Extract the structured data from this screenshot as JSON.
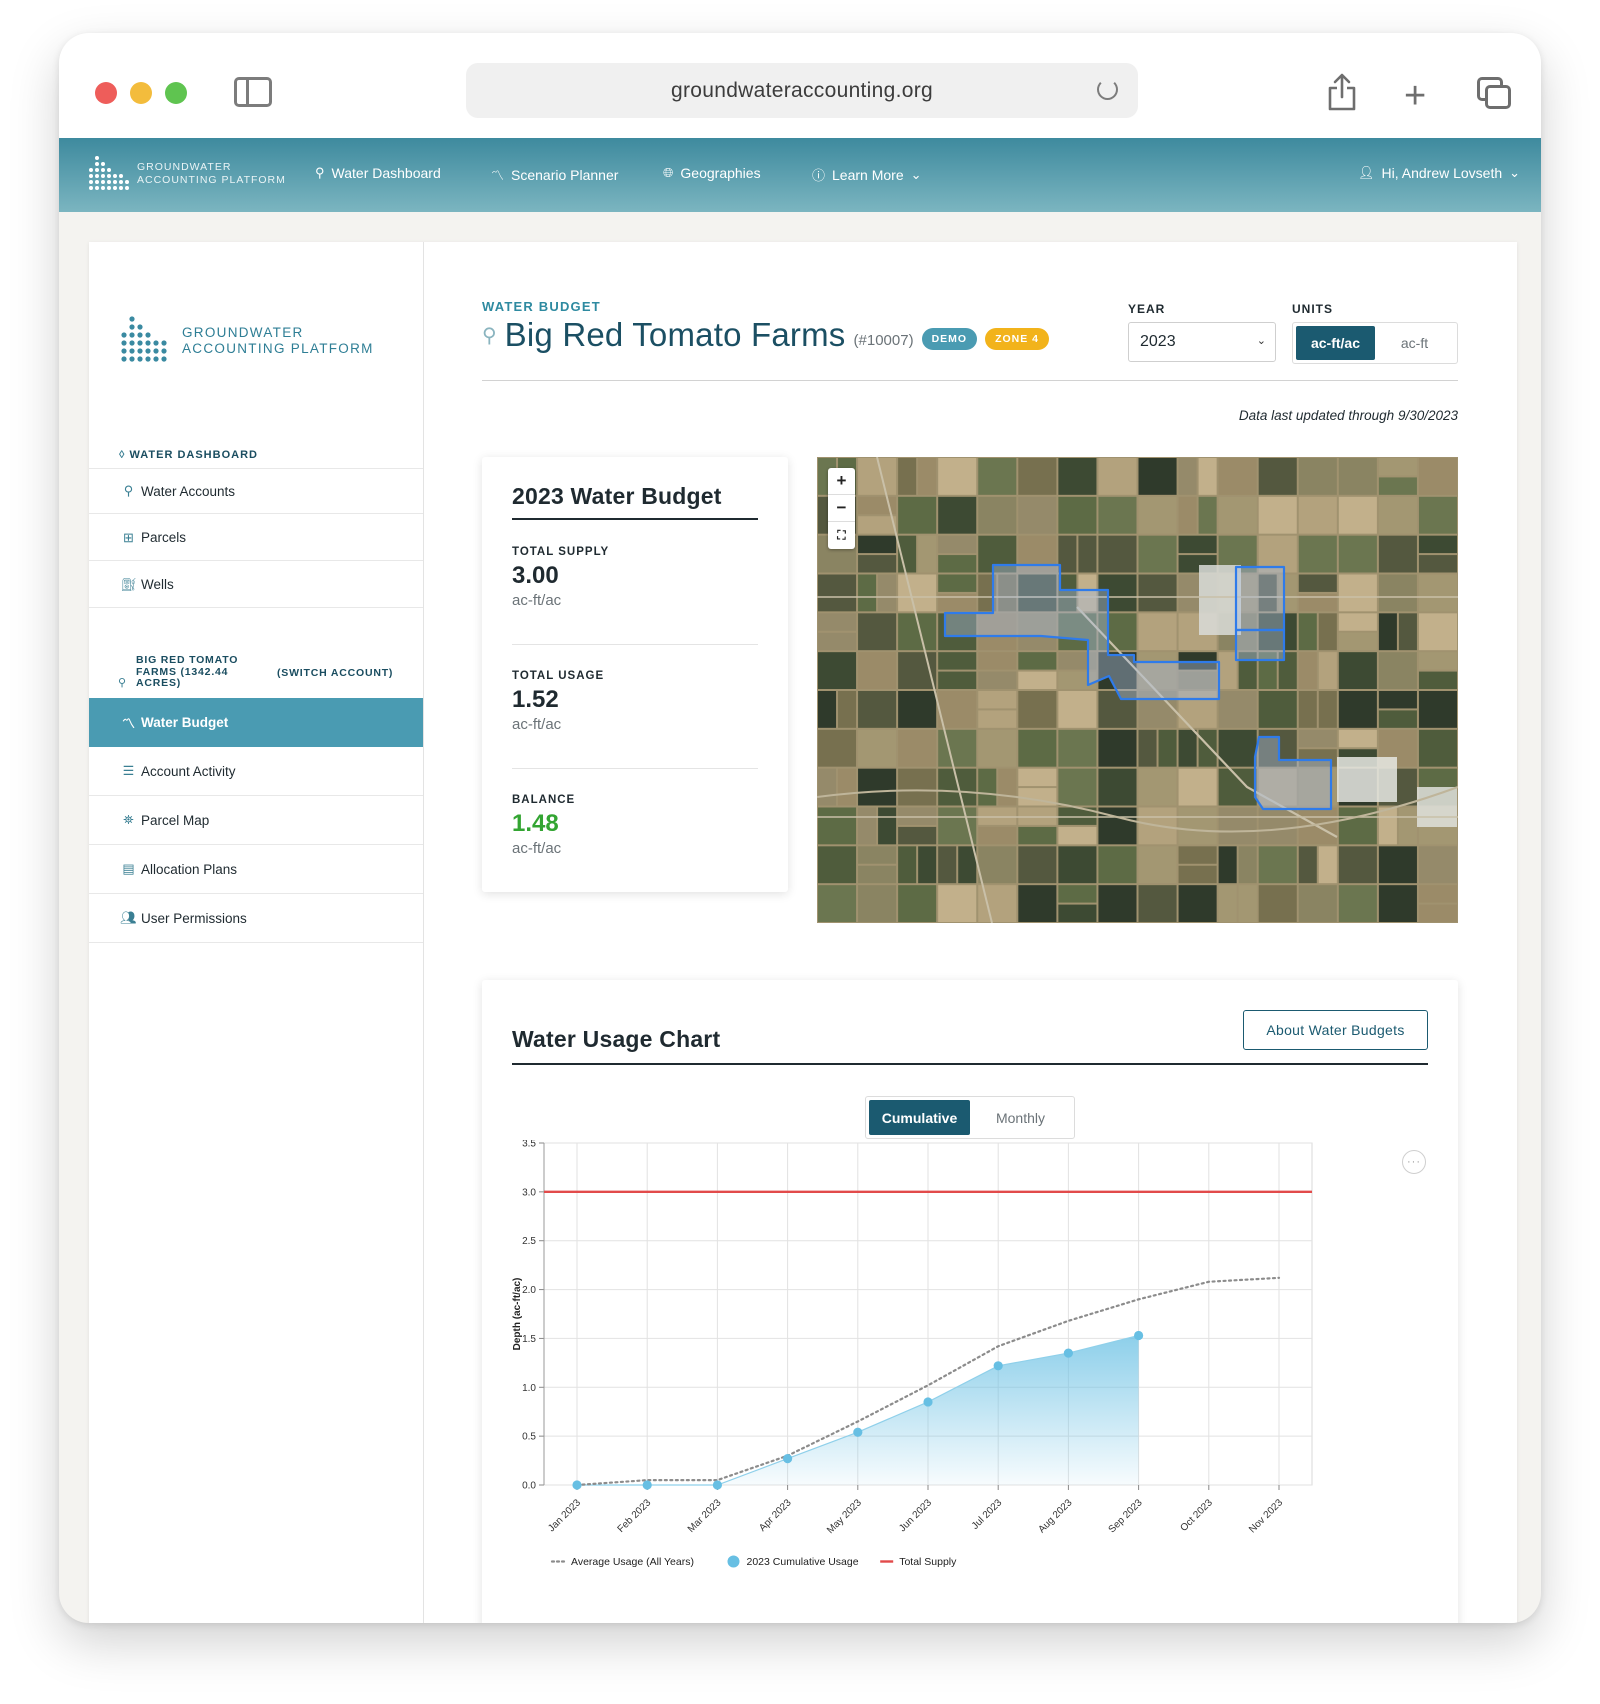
{
  "browser": {
    "url": "groundwateraccounting.org"
  },
  "topnav": {
    "brand_line1": "GROUNDWATER",
    "brand_line2": "ACCOUNTING PLATFORM",
    "items": [
      {
        "label": "Water Dashboard",
        "icon": "water-dashboard-icon"
      },
      {
        "label": "Scenario Planner",
        "icon": "chart-line-icon"
      },
      {
        "label": "Geographies",
        "icon": "globe-icon"
      },
      {
        "label": "Learn More",
        "icon": "info-icon"
      }
    ],
    "user": "Hi, Andrew Lovseth"
  },
  "sidebar": {
    "logo_line1": "GROUNDWATER",
    "logo_line2": "ACCOUNTING PLATFORM",
    "dashboard_label": "WATER DASHBOARD",
    "dashboard_items": [
      {
        "label": "Water Accounts",
        "icon": "water-account-icon"
      },
      {
        "label": "Parcels",
        "icon": "parcel-grid-icon"
      },
      {
        "label": "Wells",
        "icon": "well-icon"
      }
    ],
    "account_name": "BIG RED TOMATO FARMS (1342.44 ACRES)",
    "switch_label": "(SWITCH ACCOUNT)",
    "account_items": [
      {
        "label": "Water Budget",
        "icon": "chart-line-icon",
        "active": true
      },
      {
        "label": "Account Activity",
        "icon": "list-icon",
        "active": false
      },
      {
        "label": "Parcel Map",
        "icon": "map-icon",
        "active": false
      },
      {
        "label": "Allocation Plans",
        "icon": "document-icon",
        "active": false
      },
      {
        "label": "User Permissions",
        "icon": "users-icon",
        "active": false
      }
    ]
  },
  "header": {
    "eyebrow": "WATER BUDGET",
    "title": "Big Red Tomato Farms",
    "account_id": "(#10007)",
    "badge_demo": "DEMO",
    "badge_zone": "ZONE 4",
    "year_label": "YEAR",
    "year_value": "2023",
    "units_label": "UNITS",
    "unit_options": [
      "ac-ft/ac",
      "ac-ft"
    ],
    "unit_selected": "ac-ft/ac",
    "updated": "Data last updated through 9/30/2023"
  },
  "budget": {
    "title": "2023 Water Budget",
    "total_supply_label": "TOTAL SUPPLY",
    "total_supply_value": "3.00",
    "total_supply_unit": "ac-ft/ac",
    "total_usage_label": "TOTAL USAGE",
    "total_usage_value": "1.52",
    "total_usage_unit": "ac-ft/ac",
    "balance_label": "BALANCE",
    "balance_value": "1.48",
    "balance_unit": "ac-ft/ac",
    "balance_color": "#33a532"
  },
  "map": {
    "zoom_in": "+",
    "zoom_out": "−",
    "fullscreen_icon": "fullscreen-icon"
  },
  "chart_section": {
    "title": "Water Usage Chart",
    "about_button": "About Water Budgets",
    "toggle_options": [
      "Cumulative",
      "Monthly"
    ],
    "toggle_selected": "Cumulative",
    "more_icon": "ellipsis-icon"
  },
  "chart_data": {
    "type": "area",
    "categories": [
      "Jan 2023",
      "Feb 2023",
      "Mar 2023",
      "Apr 2023",
      "May 2023",
      "Jun 2023",
      "Jul 2023",
      "Aug 2023",
      "Sep 2023",
      "Oct 2023",
      "Nov 2023"
    ],
    "ylabel": "Depth (ac-ft/ac)",
    "ylim": [
      0,
      3.5
    ],
    "yticks": [
      "0.0",
      "0.5",
      "1.0",
      "1.5",
      "2.0",
      "2.5",
      "3.0",
      "3.5"
    ],
    "grid": true,
    "legend_position": "bottom",
    "series": [
      {
        "name": "Average Usage (All Years)",
        "style": "dotted-line",
        "color": "#8c8c8c",
        "values": [
          0.0,
          0.05,
          0.05,
          0.3,
          0.65,
          1.02,
          1.42,
          1.68,
          1.9,
          2.08,
          2.12
        ]
      },
      {
        "name": "2023 Cumulative Usage",
        "style": "area-points",
        "color": "#67bfe3",
        "values": [
          0.0,
          0.0,
          0.0,
          0.27,
          0.54,
          0.85,
          1.22,
          1.35,
          1.53
        ]
      },
      {
        "name": "Total Supply",
        "style": "line",
        "color": "#e24a4a",
        "values": [
          3.0,
          3.0,
          3.0,
          3.0,
          3.0,
          3.0,
          3.0,
          3.0,
          3.0,
          3.0,
          3.0
        ]
      }
    ]
  }
}
